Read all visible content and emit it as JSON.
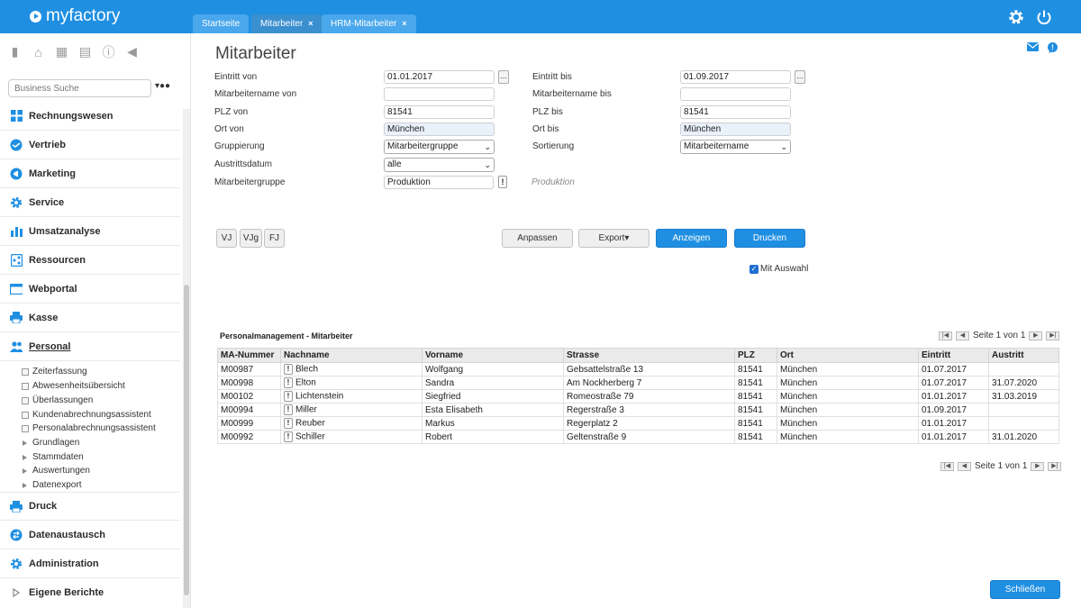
{
  "app": {
    "logo": "myfactory"
  },
  "tabs": [
    {
      "label": "Startseite",
      "closable": false,
      "active": false
    },
    {
      "label": "Mitarbeiter",
      "closable": true,
      "active": true
    },
    {
      "label": "HRM-Mitarbeiter",
      "closable": true,
      "active": false
    }
  ],
  "topbar": {
    "settings_icon": "gear-icon",
    "power_icon": "power-icon"
  },
  "sidebar": {
    "search": {
      "placeholder": "Business Suche",
      "value": ""
    },
    "nav": [
      {
        "label": "Rechnungswesen",
        "icon": "grid-icon"
      },
      {
        "label": "Vertrieb",
        "icon": "handshake-icon"
      },
      {
        "label": "Marketing",
        "icon": "megaphone-icon"
      },
      {
        "label": "Service",
        "icon": "gear-icon"
      },
      {
        "label": "Umsatzanalyse",
        "icon": "bar-chart-icon"
      },
      {
        "label": "Ressourcen",
        "icon": "share-icon"
      },
      {
        "label": "Webportal",
        "icon": "browser-icon"
      },
      {
        "label": "Kasse",
        "icon": "printer-icon"
      },
      {
        "label": "Personal",
        "icon": "users-icon"
      }
    ],
    "personal_children": [
      {
        "label": "Zeiterfassung",
        "type": "leaf"
      },
      {
        "label": "Abwesenheitsübersicht",
        "type": "leaf"
      },
      {
        "label": "Überlassungen",
        "type": "leaf"
      },
      {
        "label": "Kundenabrechnungsassistent",
        "type": "leaf"
      },
      {
        "label": "Personalabrechnungsassistent",
        "type": "leaf"
      },
      {
        "label": "Grundlagen",
        "type": "folder"
      },
      {
        "label": "Stammdaten",
        "type": "folder"
      },
      {
        "label": "Auswertungen",
        "type": "folder"
      },
      {
        "label": "Datenexport",
        "type": "folder"
      }
    ],
    "nav_bottom": [
      {
        "label": "Druck",
        "icon": "printer-icon"
      },
      {
        "label": "Datenaustausch",
        "icon": "exchange-icon"
      },
      {
        "label": "Administration",
        "icon": "gear-icon"
      },
      {
        "label": "Eigene Berichte",
        "icon": "triangle-icon"
      }
    ]
  },
  "page": {
    "title": "Mitarbeiter"
  },
  "form": {
    "eintritt_von": {
      "label": "Eintritt von",
      "value": "01.01.2017"
    },
    "eintritt_bis": {
      "label": "Eintritt bis",
      "value": "01.09.2017"
    },
    "ma_name_von": {
      "label": "Mitarbeitername von",
      "value": ""
    },
    "ma_name_bis": {
      "label": "Mitarbeitername bis",
      "value": ""
    },
    "plz_von": {
      "label": "PLZ von",
      "value": "81541"
    },
    "plz_bis": {
      "label": "PLZ bis",
      "value": "81541"
    },
    "ort_von": {
      "label": "Ort von",
      "value": "München"
    },
    "ort_bis": {
      "label": "Ort bis",
      "value": "München"
    },
    "gruppierung": {
      "label": "Gruppierung",
      "value": "Mitarbeitergruppe"
    },
    "sortierung": {
      "label": "Sortierung",
      "value": "Mitarbeitername"
    },
    "austrittsdatum": {
      "label": "Austrittsdatum",
      "value": "alle"
    },
    "ma_gruppe": {
      "label": "Mitarbeitergruppe",
      "value": "Produktion",
      "hint": "Produktion"
    },
    "lookup_label": "...",
    "excl_label": "!"
  },
  "buttons": {
    "vj": "VJ",
    "vjg": "VJg",
    "fj": "FJ",
    "anpassen": "Anpassen",
    "export": "Export▾",
    "anzeigen": "Anzeigen",
    "drucken": "Drucken",
    "schliessen": "Schließen"
  },
  "mit_auswahl": {
    "label": "Mit Auswahl",
    "checked": true
  },
  "report": {
    "title": "Personalmanagement - Mitarbeiter",
    "pager": "Seite 1 von 1",
    "columns": [
      "MA-Nummer",
      "Nachname",
      "Vorname",
      "Strasse",
      "PLZ",
      "Ort",
      "Eintritt",
      "Austritt"
    ],
    "rows": [
      [
        "M00987",
        "Blech",
        "Wolfgang",
        "Gebsattelstraße 13",
        "81541",
        "München",
        "01.07.2017",
        ""
      ],
      [
        "M00998",
        "Elton",
        "Sandra",
        "Am Nockherberg 7",
        "81541",
        "München",
        "01.07.2017",
        "31.07.2020"
      ],
      [
        "M00102",
        "Lichtenstein",
        "Siegfried",
        "Romeostraße 79",
        "81541",
        "München",
        "01.01.2017",
        "31.03.2019"
      ],
      [
        "M00994",
        "Miller",
        "Esta Elisabeth",
        "Regerstraße 3",
        "81541",
        "München",
        "01.09.2017",
        ""
      ],
      [
        "M00999",
        "Reuber",
        "Markus",
        "Regerplatz 2",
        "81541",
        "München",
        "01.01.2017",
        ""
      ],
      [
        "M00992",
        "Schiller",
        "Robert",
        "Geltenstraße 9",
        "81541",
        "München",
        "01.01.2017",
        "31.01.2020"
      ]
    ]
  },
  "colors": {
    "brand": "#1f8fe2",
    "header_bg": "#eaeaea"
  }
}
